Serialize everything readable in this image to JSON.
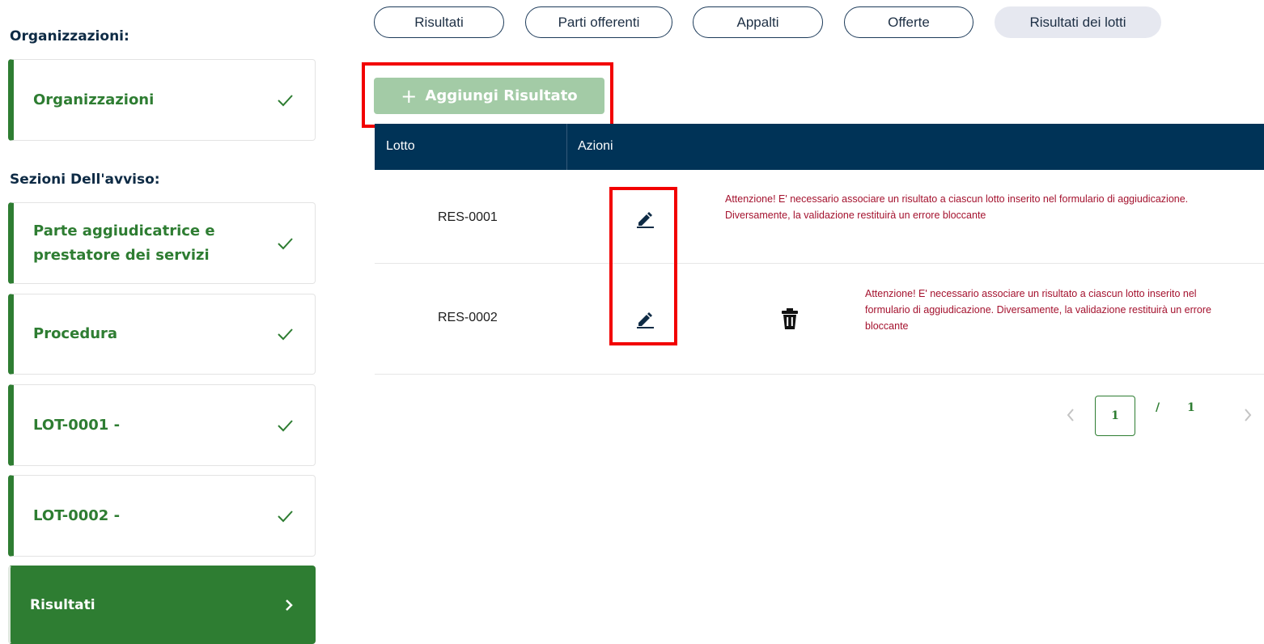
{
  "sidebar": {
    "org_heading": "Organizzazioni:",
    "org_items": [
      {
        "label": "Organizzazioni"
      }
    ],
    "sections_heading": "Sezioni Dell'avviso:",
    "section_items": [
      {
        "label": "Parte aggiudicatrice e prestatore dei servizi"
      },
      {
        "label": "Procedura"
      },
      {
        "label": "LOT-0001 -"
      },
      {
        "label": "LOT-0002 -"
      },
      {
        "label": "Risultati",
        "active": true
      }
    ]
  },
  "tabs": [
    "Risultati",
    "Parti offerenti",
    "Appalti",
    "Offerte",
    "Risultati dei lotti"
  ],
  "active_tab": "Risultati dei lotti",
  "toolbar": {
    "add_plus": "+",
    "add_label": "Aggiungi Risultato"
  },
  "table": {
    "headers": [
      "Lotto",
      "Azioni"
    ],
    "rows": [
      {
        "code": "RES-0001",
        "warning": "Attenzione! E' necessario associare un risultato a ciascun lotto inserito nel formulario di aggiudicazione. Diversamente, la validazione restituirà un errore bloccante"
      },
      {
        "code": "RES-0002",
        "warning": "Attenzione! E' necessario associare un risultato a ciascun lotto inserito nel formulario di aggiudicazione. Diversamente, la validazione restituirà un errore bloccante"
      }
    ]
  },
  "pagination": {
    "current": "1",
    "separator": "/",
    "total": "1"
  },
  "colors": {
    "primary_green": "#2e7d32",
    "header_navy": "#003357",
    "warning_red": "#a4122e",
    "highlight_red": "#f20000"
  },
  "icons": [
    "check-icon",
    "chevron-right-icon",
    "plus-icon",
    "pencil-icon",
    "trash-icon",
    "chevron-left-icon"
  ]
}
